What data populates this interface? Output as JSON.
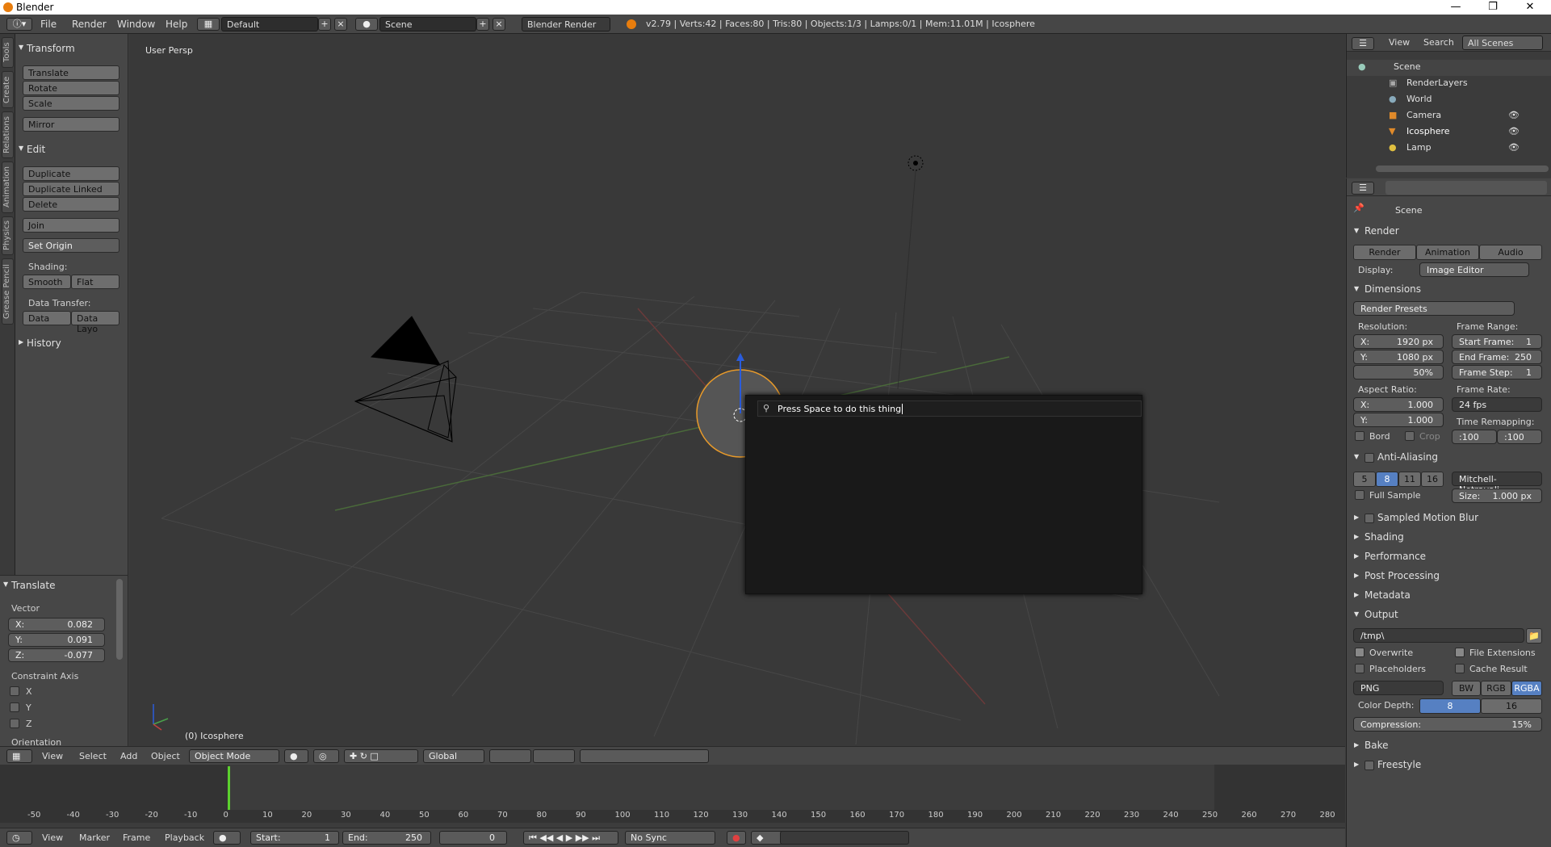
{
  "titlebar": {
    "title": "Blender"
  },
  "topbar": {
    "menus": [
      "File",
      "Render",
      "Window",
      "Help"
    ],
    "layout": "Default",
    "scene": "Scene",
    "engine": "Blender Render",
    "stats": "v2.79 | Verts:42 | Faces:80 | Tris:80 | Objects:1/3 | Lamps:0/1 | Mem:11.01M | Icosphere"
  },
  "lefttabs": [
    "Tools",
    "Create",
    "Relations",
    "Animation",
    "Physics",
    "Grease Pencil"
  ],
  "shelf": {
    "transform_title": "Transform",
    "translate": "Translate",
    "rotate": "Rotate",
    "scale": "Scale",
    "mirror": "Mirror",
    "edit_title": "Edit",
    "duplicate": "Duplicate",
    "duplicate_linked": "Duplicate Linked",
    "delete": "Delete",
    "join": "Join",
    "set_origin": "Set Origin",
    "shading_label": "Shading:",
    "smooth": "Smooth",
    "flat": "Flat",
    "data_transfer_label": "Data Transfer:",
    "data": "Data",
    "data_layo": "Data Layo",
    "history": "History"
  },
  "operator": {
    "title": "Translate",
    "vector_label": "Vector",
    "x_label": "X:",
    "x": "0.082",
    "y_label": "Y:",
    "y": "0.091",
    "z_label": "Z:",
    "z": "-0.077",
    "constraint_label": "Constraint Axis",
    "cx": "X",
    "cy": "Y",
    "cz": "Z",
    "orientation": "Orientation"
  },
  "viewport": {
    "view_name": "User Persp",
    "object_label": "(0) Icosphere"
  },
  "search_popup": {
    "text": "Press Space to do this thing"
  },
  "view_header": {
    "menus": [
      "View",
      "Select",
      "Add",
      "Object"
    ],
    "mode": "Object Mode",
    "orientation": "Global"
  },
  "timeline": {
    "ticks": [
      "-50",
      "-40",
      "-30",
      "-20",
      "-10",
      "0",
      "10",
      "20",
      "30",
      "40",
      "50",
      "60",
      "70",
      "80",
      "90",
      "100",
      "110",
      "120",
      "130",
      "140",
      "150",
      "160",
      "170",
      "180",
      "190",
      "200",
      "210",
      "220",
      "230",
      "240",
      "250",
      "260",
      "270",
      "280"
    ],
    "menus": [
      "View",
      "Marker",
      "Frame",
      "Playback"
    ],
    "start_label": "Start:",
    "start": "1",
    "end_label": "End:",
    "end": "250",
    "current": "0",
    "sync": "No Sync"
  },
  "outliner": {
    "menus": [
      "View",
      "Search"
    ],
    "filter": "All Scenes",
    "items": [
      "Scene",
      "RenderLayers",
      "World",
      "Camera",
      "Icosphere",
      "Lamp"
    ]
  },
  "properties": {
    "breadcrumb": "Scene",
    "render_section": "Render",
    "render_btn": "Render",
    "animation_btn": "Animation",
    "audio_btn": "Audio",
    "display_label": "Display:",
    "display_value": "Image Editor",
    "dimensions_section": "Dimensions",
    "render_presets": "Render Presets",
    "resolution_label": "Resolution:",
    "res_x_label": "X:",
    "res_x": "1920 px",
    "res_y_label": "Y:",
    "res_y": "1080 px",
    "res_pct": "50%",
    "frame_range_label": "Frame Range:",
    "start_frame_label": "Start Frame:",
    "start_frame": "1",
    "end_frame_label": "End Frame:",
    "end_frame": "250",
    "frame_step_label": "Frame Step:",
    "frame_step": "1",
    "aspect_label": "Aspect Ratio:",
    "asp_x_label": "X:",
    "asp_x": "1.000",
    "asp_y_label": "Y:",
    "asp_y": "1.000",
    "frame_rate_label": "Frame Rate:",
    "frame_rate": "24 fps",
    "time_remap_label": "Time Remapping:",
    "remap_old": ":100",
    "remap_new": ":100",
    "bord": "Bord",
    "crop": "Crop",
    "aa_section": "Anti-Aliasing",
    "aa_samples": [
      "5",
      "8",
      "11",
      "16"
    ],
    "aa_filter": "Mitchell-Netravali",
    "full_sample": "Full Sample",
    "size_label": "Size:",
    "size": "1.000 px",
    "closed_sections": [
      "Sampled Motion Blur",
      "Shading",
      "Performance",
      "Post Processing",
      "Metadata"
    ],
    "output_section": "Output",
    "output_path": "/tmp\\",
    "overwrite": "Overwrite",
    "file_extensions": "File Extensions",
    "placeholders": "Placeholders",
    "cache_result": "Cache Result",
    "format": "PNG",
    "bw": "BW",
    "rgb": "RGB",
    "rgba": "RGBA",
    "color_depth_label": "Color Depth:",
    "depth_8": "8",
    "depth_16": "16",
    "compression_label": "Compression:",
    "compression": "15%",
    "bake_section": "Bake",
    "freestyle_section": "Freestyle"
  },
  "colors": {
    "selected": "#5680c2",
    "accent": "#e87d0d"
  }
}
